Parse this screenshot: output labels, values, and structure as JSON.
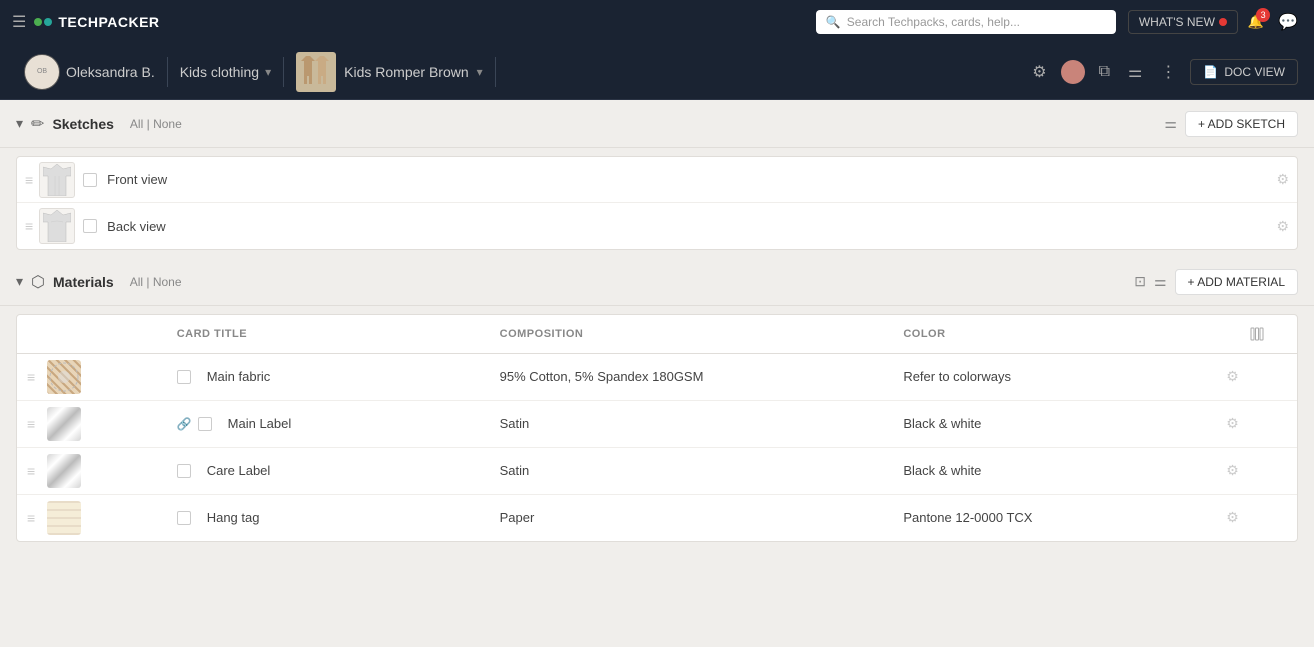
{
  "topNav": {
    "hamburger": "☰",
    "logoText": "TECHPACKER",
    "searchPlaceholder": "Search Techpacks, cards, help...",
    "whatsNew": "WHAT'S NEW",
    "notificationCount": "3"
  },
  "breadcrumb": {
    "userName": "Oleksandra B.",
    "collection": "Kids clothing",
    "product": "Kids Romper Brown"
  },
  "sketches": {
    "title": "Sketches",
    "filterAll": "All",
    "filterNone": "None",
    "addLabel": "+ ADD SKETCH",
    "rows": [
      {
        "label": "Front view"
      },
      {
        "label": "Back view"
      }
    ]
  },
  "materials": {
    "title": "Materials",
    "filterAll": "All",
    "filterNone": "None",
    "addLabel": "+ ADD MATERIAL",
    "columns": {
      "cardTitle": "Card Title",
      "composition": "COMPOSITION",
      "color": "COLOR"
    },
    "rows": [
      {
        "label": "Main fabric",
        "composition": "95% Cotton, 5% Spandex 180GSM",
        "color": "Refer to colorways",
        "fabricType": "brown"
      },
      {
        "label": "Main Label",
        "composition": "Satin",
        "color": "Black & white",
        "fabricType": "satin1",
        "linked": true
      },
      {
        "label": "Care Label",
        "composition": "Satin",
        "color": "Black & white",
        "fabricType": "satin2"
      },
      {
        "label": "Hang tag",
        "composition": "Paper",
        "color": "Pantone 12-0000 TCX",
        "fabricType": "paper"
      }
    ]
  }
}
